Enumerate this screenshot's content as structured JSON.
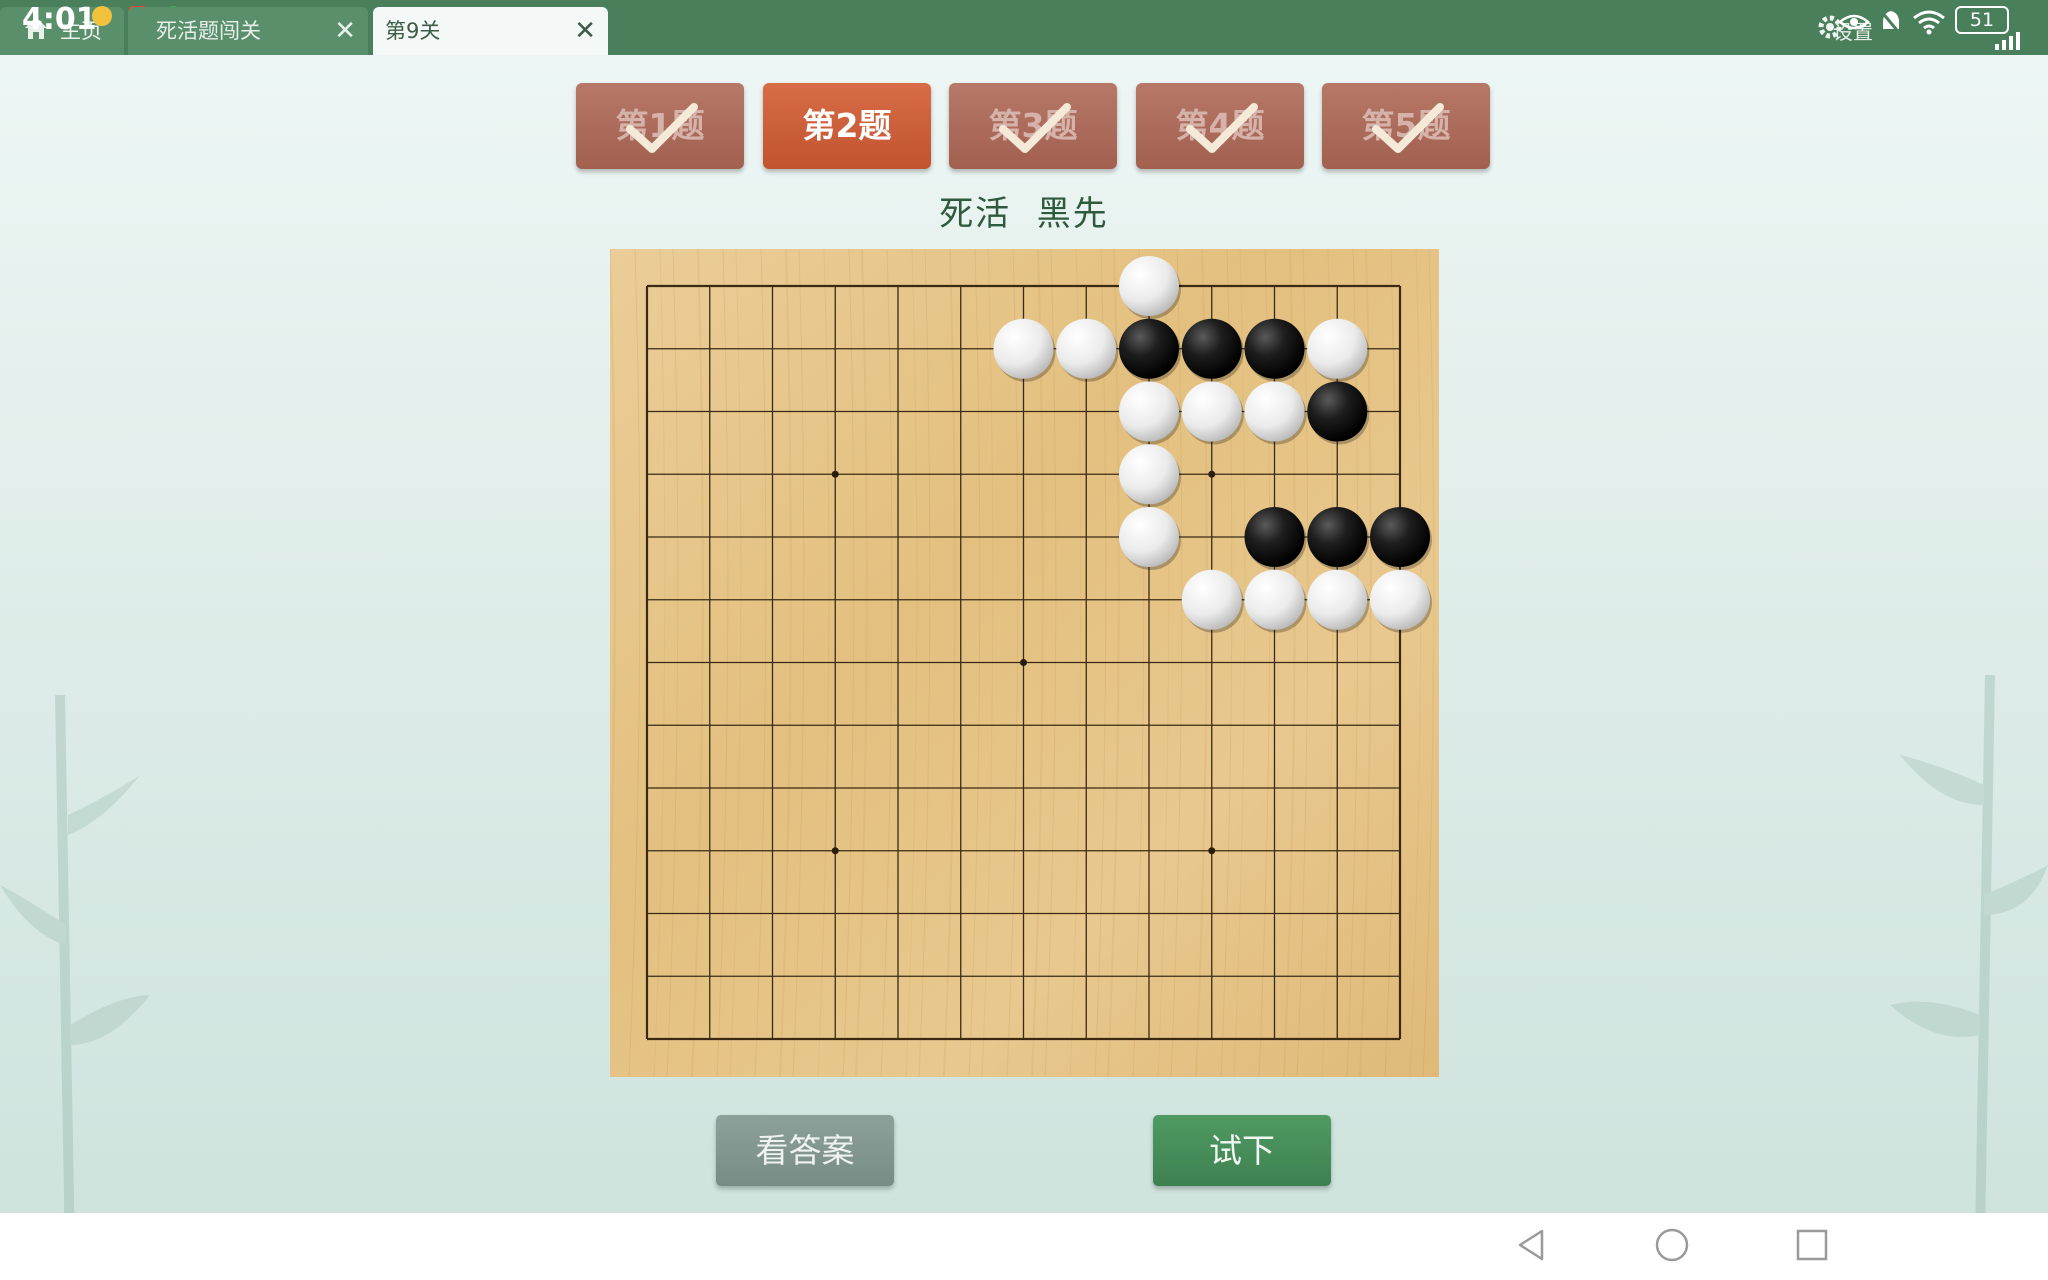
{
  "statusbar": {
    "time": "4:01",
    "battery": "51"
  },
  "tabs": [
    {
      "label": "主页"
    },
    {
      "label": "死活题闯关"
    },
    {
      "label": "第9关"
    }
  ],
  "tab_close_label": "✕",
  "settings_label": "设置",
  "problems": [
    {
      "label": "第1题",
      "solved": true
    },
    {
      "label": "第2题",
      "solved": false,
      "active": true
    },
    {
      "label": "第3题",
      "solved": true
    },
    {
      "label": "第4题",
      "solved": true
    },
    {
      "label": "第5题",
      "solved": true
    }
  ],
  "subtitle": "死活  黑先",
  "board": {
    "size": 13,
    "star_points": [
      [
        3,
        3
      ],
      [
        3,
        9
      ],
      [
        9,
        3
      ],
      [
        9,
        9
      ],
      [
        6,
        6
      ]
    ],
    "stones": [
      {
        "color": "white",
        "col": 8,
        "row": 0
      },
      {
        "color": "white",
        "col": 6,
        "row": 1
      },
      {
        "color": "white",
        "col": 7,
        "row": 1
      },
      {
        "color": "black",
        "col": 8,
        "row": 1
      },
      {
        "color": "black",
        "col": 9,
        "row": 1
      },
      {
        "color": "black",
        "col": 10,
        "row": 1
      },
      {
        "color": "white",
        "col": 11,
        "row": 1
      },
      {
        "color": "white",
        "col": 8,
        "row": 2
      },
      {
        "color": "white",
        "col": 9,
        "row": 2
      },
      {
        "color": "white",
        "col": 10,
        "row": 2
      },
      {
        "color": "black",
        "col": 11,
        "row": 2
      },
      {
        "color": "white",
        "col": 8,
        "row": 3
      },
      {
        "color": "white",
        "col": 8,
        "row": 4
      },
      {
        "color": "black",
        "col": 10,
        "row": 4
      },
      {
        "color": "black",
        "col": 11,
        "row": 4
      },
      {
        "color": "black",
        "col": 12,
        "row": 4
      },
      {
        "color": "white",
        "col": 9,
        "row": 5
      },
      {
        "color": "white",
        "col": 10,
        "row": 5
      },
      {
        "color": "white",
        "col": 11,
        "row": 5
      },
      {
        "color": "white",
        "col": 12,
        "row": 5
      }
    ]
  },
  "buttons": {
    "show_answer": "看答案",
    "try": "试下"
  },
  "colors": {
    "topbar": "#4a7f5c",
    "active_problem": "#c95b35",
    "problem": "#a9685a",
    "try_button": "#43875a",
    "answer_button": "#829690"
  }
}
